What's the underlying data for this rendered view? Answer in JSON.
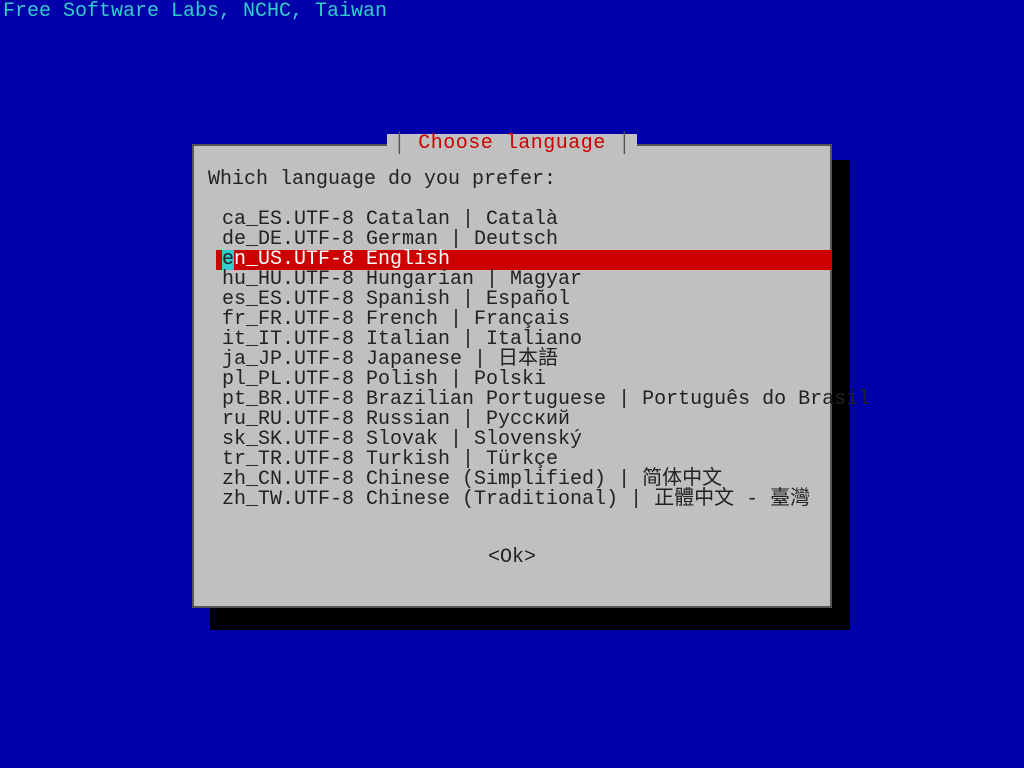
{
  "header": "Free Software Labs, NCHC, Taiwan",
  "dialog": {
    "title": "Choose language",
    "prompt": "Which language do you prefer:",
    "ok_label": "<Ok>",
    "selected_index": 2,
    "items": [
      {
        "hotkey": " ",
        "label": "ca_ES.UTF-8 Catalan | Català"
      },
      {
        "hotkey": " ",
        "label": "de_DE.UTF-8 German | Deutsch"
      },
      {
        "hotkey": "e",
        "label": "n_US.UTF-8 English"
      },
      {
        "hotkey": " ",
        "label": "hu_HU.UTF-8 Hungarian | Magyar"
      },
      {
        "hotkey": " ",
        "label": "es_ES.UTF-8 Spanish | Español"
      },
      {
        "hotkey": " ",
        "label": "fr_FR.UTF-8 French | Français"
      },
      {
        "hotkey": " ",
        "label": "it_IT.UTF-8 Italian | Italiano"
      },
      {
        "hotkey": " ",
        "label": "ja_JP.UTF-8 Japanese | 日本語"
      },
      {
        "hotkey": " ",
        "label": "pl_PL.UTF-8 Polish | Polski"
      },
      {
        "hotkey": " ",
        "label": "pt_BR.UTF-8 Brazilian Portuguese | Português do Brasil"
      },
      {
        "hotkey": " ",
        "label": "ru_RU.UTF-8 Russian | Русский"
      },
      {
        "hotkey": " ",
        "label": "sk_SK.UTF-8 Slovak | Slovenský"
      },
      {
        "hotkey": " ",
        "label": "tr_TR.UTF-8 Turkish | Türkçe"
      },
      {
        "hotkey": " ",
        "label": "zh_CN.UTF-8 Chinese (Simplified) | 简体中文"
      },
      {
        "hotkey": " ",
        "label": "zh_TW.UTF-8 Chinese (Traditional) | 正體中文 - 臺灣"
      }
    ]
  }
}
